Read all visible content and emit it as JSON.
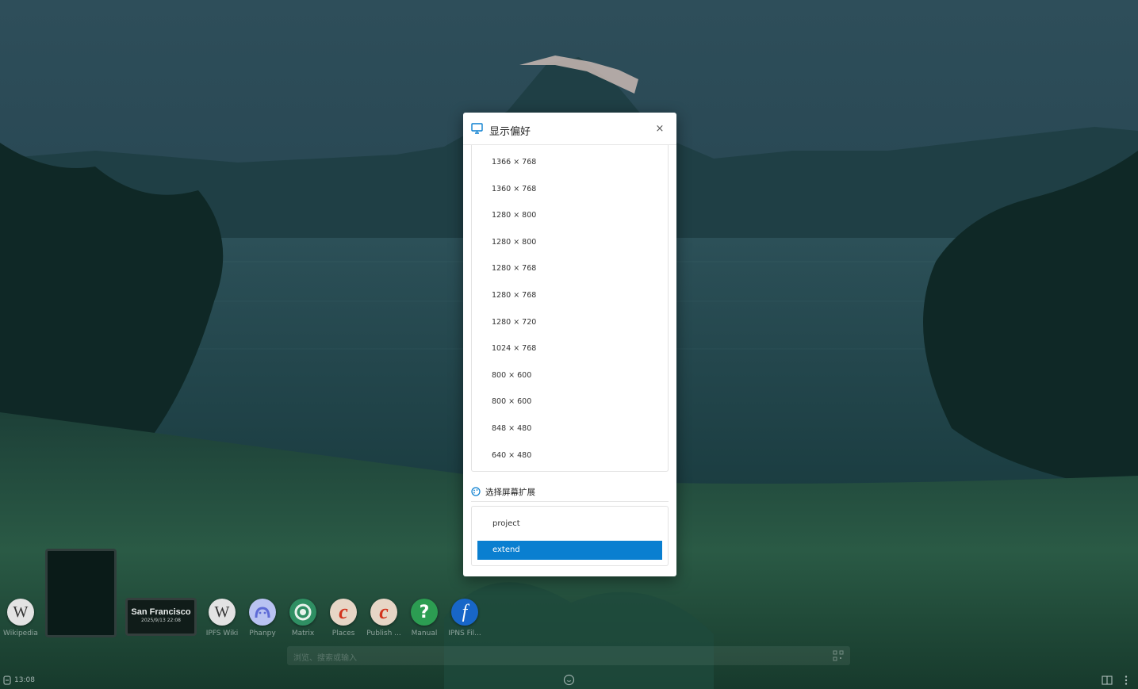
{
  "dialog": {
    "title": "显示偏好",
    "icon": "monitor-icon",
    "close_label": "×",
    "resolutions": [
      "1366 × 768",
      "1360 × 768",
      "1280 × 800",
      "1280 × 800",
      "1280 × 768",
      "1280 × 768",
      "1280 × 720",
      "1024 × 768",
      "800 × 600",
      "800 × 600",
      "848 × 480",
      "640 × 480"
    ],
    "extension_section_title": "选择屏幕扩展",
    "extension_section_icon": "palette-icon",
    "extension_modes": [
      "project",
      "extend"
    ],
    "selected_mode": "extend",
    "accent_color": "#0a7fd0"
  },
  "dock": {
    "apps": [
      {
        "label": "Wikipedia",
        "icon": "wikipedia-icon"
      },
      {
        "label": "IPFS Wiki",
        "icon": "wikipedia-icon"
      },
      {
        "label": "Phanpy",
        "icon": "phanpy-icon"
      },
      {
        "label": "Matrix",
        "icon": "matrix-icon"
      },
      {
        "label": "Places",
        "icon": "places-icon"
      },
      {
        "label": "Publish ...",
        "icon": "publish-icon"
      },
      {
        "label": "Manual",
        "icon": "manual-icon"
      },
      {
        "label": "IPNS Fil...",
        "icon": "ipns-icon"
      }
    ],
    "clock_widget": {
      "city": "San Francisco",
      "datetime": "2025/9/13 22:08"
    }
  },
  "search": {
    "placeholder": "浏览、搜索或输入"
  },
  "status_bar": {
    "time": "13:08"
  }
}
